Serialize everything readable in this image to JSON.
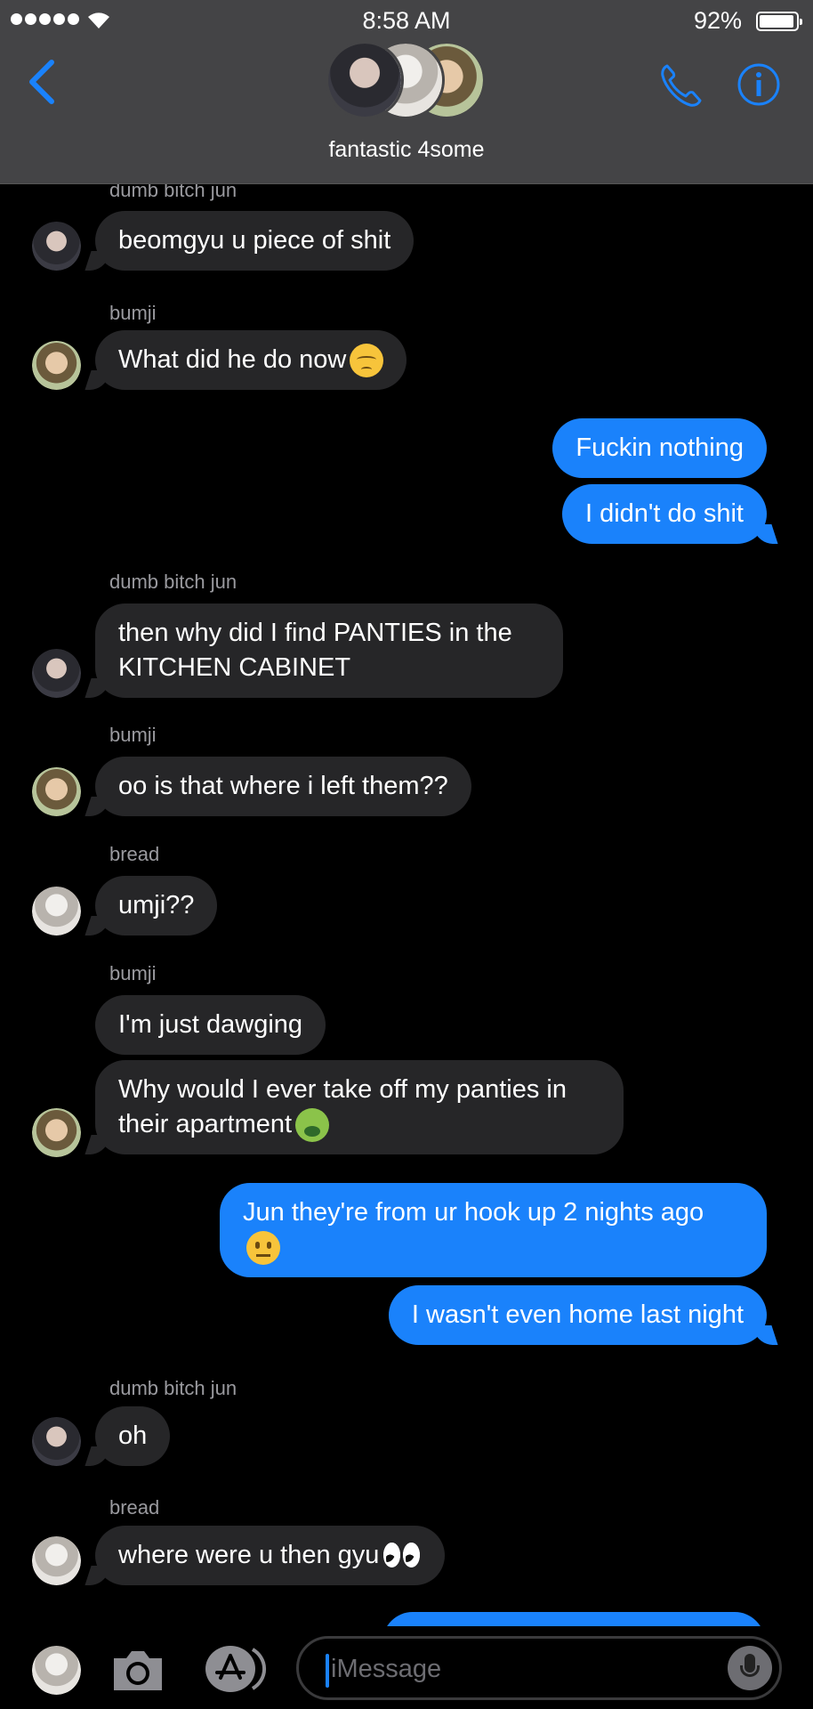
{
  "status_bar": {
    "time": "8:58 AM",
    "battery": "92%",
    "battery_level": 0.92
  },
  "header": {
    "group_name": "fantastic 4some"
  },
  "messages": [
    {
      "sender": "dumb bitch jun",
      "text": "beomgyu u piece of shit"
    },
    {
      "sender": "bumji",
      "text": "What did he do now"
    },
    {
      "text": "Fuckin nothing"
    },
    {
      "text": "I didn't do shit"
    },
    {
      "sender": "dumb bitch jun",
      "text": "then why did I find PANTIES in the KITCHEN CABINET"
    },
    {
      "sender": "bumji",
      "text": "oo is that where i left them??"
    },
    {
      "sender": "bread",
      "text": "umji??"
    },
    {
      "sender": "bumji",
      "text": "I'm just dawging"
    },
    {
      "text": "Why would I ever take off my panties in their apartment"
    },
    {
      "text": "Jun they're from ur hook up 2 nights ago"
    },
    {
      "text": "I wasn't even home last night"
    },
    {
      "sender": "dumb bitch jun",
      "text": "oh"
    },
    {
      "sender": "bread",
      "text": "where were u then gyu"
    }
  ],
  "input": {
    "placeholder": "iMessage"
  },
  "icons": {
    "back": "chevron-left-icon",
    "call": "phone-icon",
    "info": "info-icon",
    "camera": "camera-icon",
    "apps": "app-store-icon",
    "mic": "microphone-icon"
  },
  "colors": {
    "accent": "#1a82fb",
    "incoming_bubble": "#262628",
    "header": "#444446"
  }
}
